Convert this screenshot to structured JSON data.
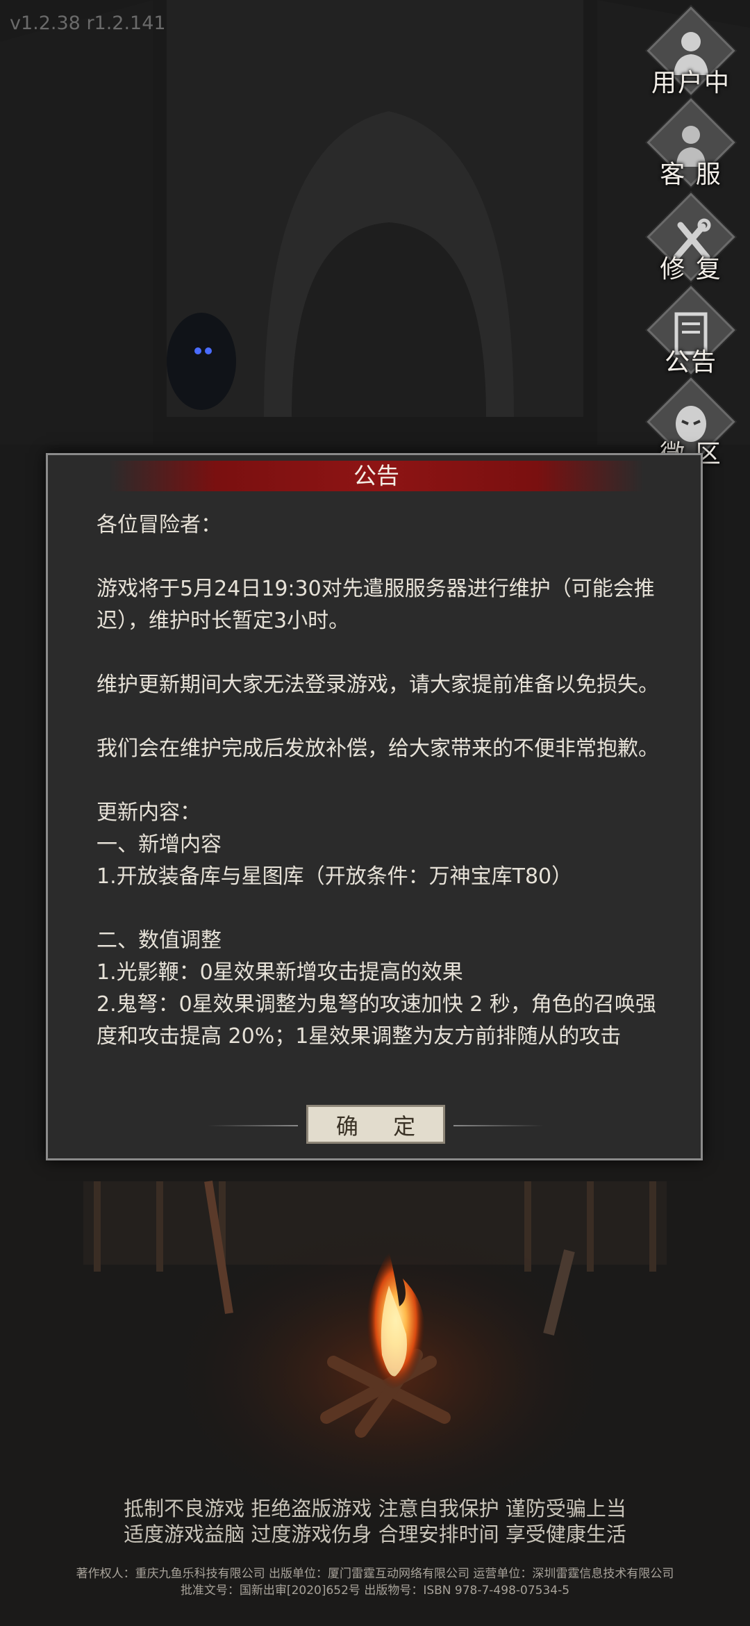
{
  "version": "v1.2.38 r1.2.141",
  "side_menu": [
    {
      "label": "用户中心",
      "icon": "user-icon"
    },
    {
      "label": "客 服",
      "icon": "headset-icon"
    },
    {
      "label": "修 复",
      "icon": "wrench-icon"
    },
    {
      "label": "公告",
      "icon": "notice-icon"
    },
    {
      "label": "微 区",
      "icon": "community-icon"
    }
  ],
  "modal": {
    "title": "公告",
    "body": [
      "各位冒险者：",
      "",
      "游戏将于5月24日19:30对先遣服服务器进行维护（可能会推迟），维护时长暂定3小时。",
      "",
      "维护更新期间大家无法登录游戏，请大家提前准备以免损失。",
      "",
      "我们会在维护完成后发放补偿，给大家带来的不便非常抱歉。",
      "",
      "更新内容：",
      "一、新增内容",
      "1.开放装备库与星图库（开放条件：万神宝库T80）",
      "",
      "二、数值调整",
      "1.光影鞭：0星效果新增攻击提高的效果",
      "2.鬼弩：0星效果调整为鬼弩的攻速加快 2 秒，角色的召唤强度和攻击提高 20%；1星效果调整为友方前排随从的攻击"
    ],
    "confirm_label": "确 定"
  },
  "footer": {
    "notice_line1": "抵制不良游戏 拒绝盗版游戏 注意自我保护 谨防受骗上当",
    "notice_line2": "适度游戏益脑 过度游戏伤身 合理安排时间 享受健康生活",
    "copyright_line1": "著作权人：重庆九鱼乐科技有限公司 出版单位：厦门雷霆互动网络有限公司 运营单位：深圳雷霆信息技术有限公司",
    "copyright_line2": "批准文号：国新出审[2020]652号 出版物号：ISBN 978-7-498-07534-5"
  },
  "colors": {
    "title_bar": "#8e1414",
    "modal_bg": "#2b2b2b",
    "confirm_bg": "#e2dccd"
  }
}
